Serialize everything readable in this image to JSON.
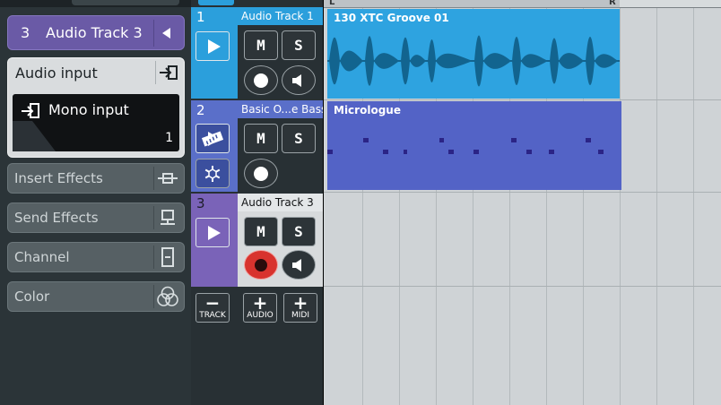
{
  "inspector": {
    "track_header": {
      "number": "3",
      "name": "Audio Track 3"
    },
    "audio_input": {
      "label": "Audio input",
      "selected": "Mono input",
      "channel": "1"
    },
    "sections": [
      {
        "label": "Insert Effects",
        "icon": "insert-effects-icon"
      },
      {
        "label": "Send Effects",
        "icon": "send-effects-icon"
      },
      {
        "label": "Channel",
        "icon": "channel-icon"
      },
      {
        "label": "Color",
        "icon": "color-circles-icon"
      }
    ]
  },
  "tracks": [
    {
      "number": "1",
      "name": "Audio Track 1",
      "type": "audio",
      "color": "#2b9fdc"
    },
    {
      "number": "2",
      "name": "Basic O...e Bass",
      "type": "instrument",
      "color": "#5a6fc9"
    },
    {
      "number": "3",
      "name": "Audio Track 3",
      "type": "audio",
      "color": "#7a63b8"
    }
  ],
  "track_buttons": {
    "mute": "M",
    "solo": "S"
  },
  "add_bar": [
    {
      "symbol": "−",
      "label": "TRACK"
    },
    {
      "symbol": "+",
      "label": "AUDIO"
    },
    {
      "symbol": "+",
      "label": "MIDI"
    }
  ],
  "ruler": {
    "left_locator": "L",
    "right_locator": "R"
  },
  "events": [
    {
      "title": "130 XTC Groove 01",
      "track": 1,
      "color": "#2ea3e0"
    },
    {
      "title": "Micrologue",
      "track": 2,
      "color": "#5363c6"
    }
  ]
}
